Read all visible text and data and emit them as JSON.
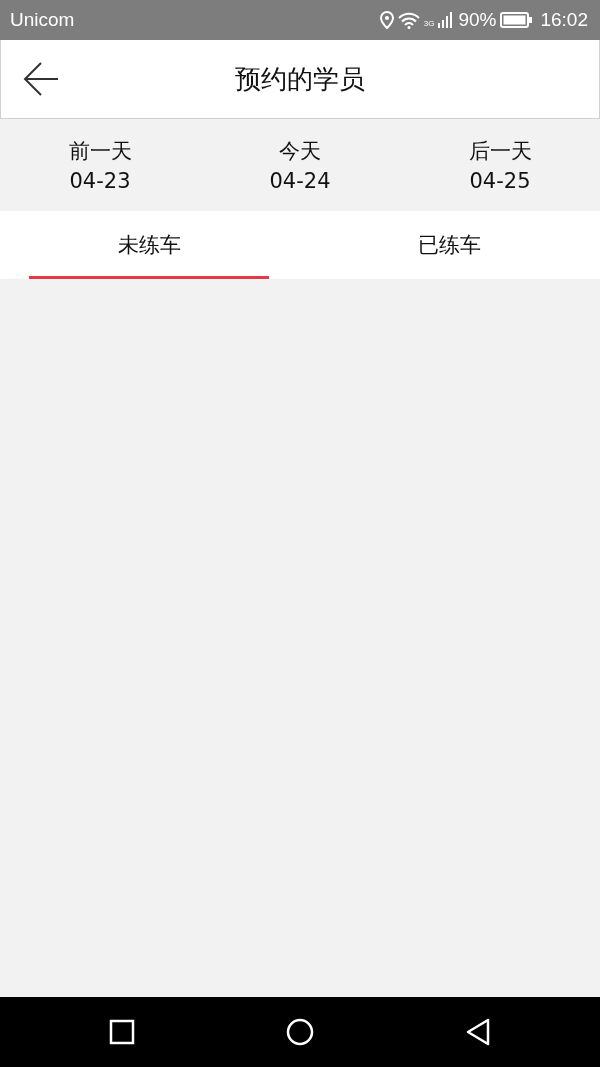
{
  "status_bar": {
    "carrier": "Unicom",
    "network": "3G",
    "battery": "90%",
    "time": "16:02"
  },
  "header": {
    "title": "预约的学员"
  },
  "days": [
    {
      "label": "前一天",
      "date": "04-23"
    },
    {
      "label": "今天",
      "date": "04-24"
    },
    {
      "label": "后一天",
      "date": "04-25"
    }
  ],
  "tabs": [
    {
      "label": "未练车",
      "selected": true
    },
    {
      "label": "已练车",
      "selected": false
    }
  ]
}
